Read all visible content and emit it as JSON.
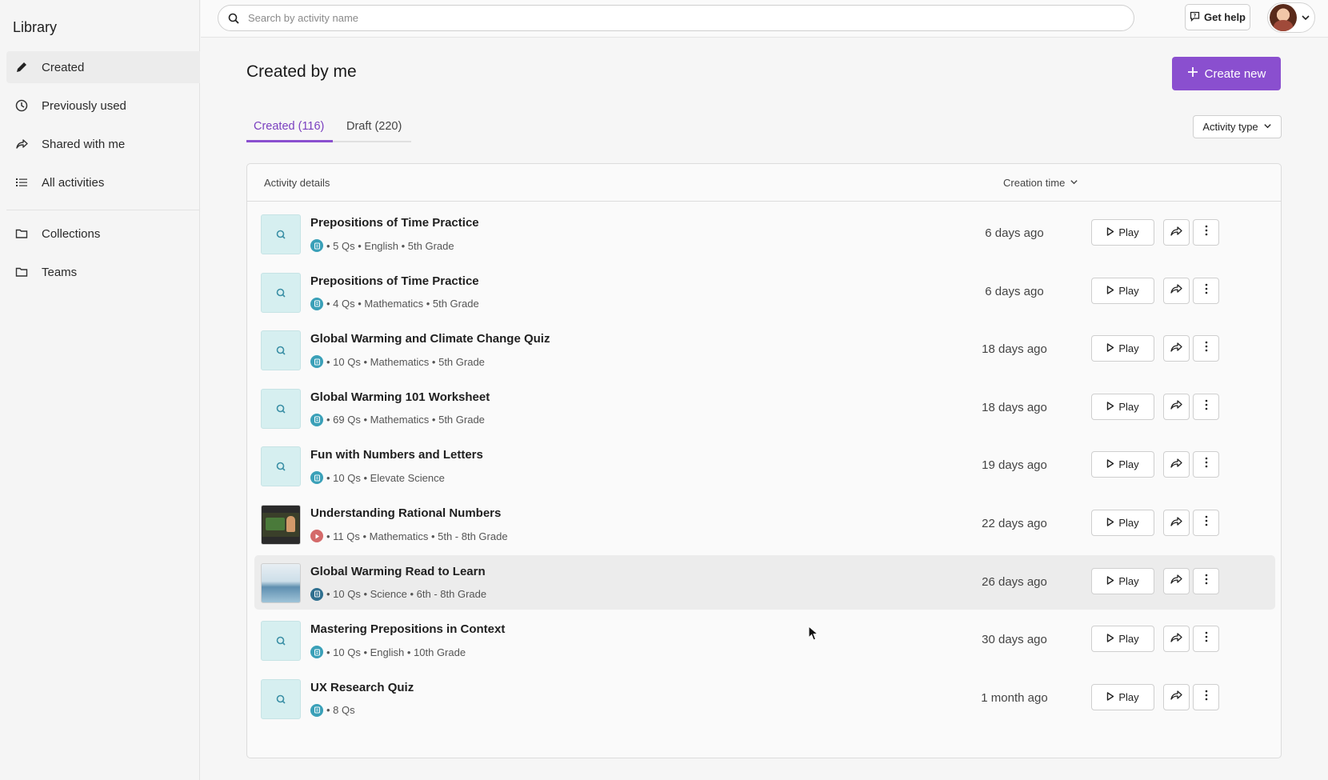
{
  "sidebar": {
    "title": "Library",
    "items": [
      {
        "label": "Created",
        "icon": "pencil-icon",
        "active": true
      },
      {
        "label": "Previously used",
        "icon": "clock-icon"
      },
      {
        "label": "Shared with me",
        "icon": "share-icon"
      },
      {
        "label": "All activities",
        "icon": "list-icon"
      },
      {
        "label": "Collections",
        "icon": "folder-icon"
      },
      {
        "label": "Teams",
        "icon": "folder-icon"
      }
    ]
  },
  "topbar": {
    "search_placeholder": "Search by activity name",
    "get_help": "Get help"
  },
  "header": {
    "title": "Created by me",
    "create_new": "Create new"
  },
  "tabs": [
    {
      "label": "Created (116)",
      "active": true
    },
    {
      "label": "Draft (220)"
    }
  ],
  "filter": {
    "activity_type": "Activity type"
  },
  "table": {
    "col_details": "Activity details",
    "col_time": "Creation time",
    "rows": [
      {
        "title": "Prepositions of Time Practice",
        "meta": "• 5 Qs • English • 5th Grade",
        "time": "6 days ago"
      },
      {
        "title": "Prepositions of Time Practice",
        "meta": "• 4 Qs • Mathematics • 5th Grade",
        "time": "6 days ago"
      },
      {
        "title": "Global Warming and Climate Change Quiz",
        "meta": "• 10 Qs • Mathematics • 5th Grade",
        "time": "18 days ago"
      },
      {
        "title": "Global Warming 101 Worksheet",
        "meta": "• 69 Qs • Mathematics • 5th Grade",
        "time": "18 days ago"
      },
      {
        "title": "Fun with Numbers and Letters",
        "meta": "• 10 Qs • Elevate Science",
        "time": "19 days ago"
      },
      {
        "title": "Understanding Rational Numbers",
        "meta": "• 11 Qs • Mathematics • 5th - 8th Grade",
        "time": "22 days ago"
      },
      {
        "title": "Global Warming Read to Learn",
        "meta": "• 10 Qs • Science • 6th - 8th Grade",
        "time": "26 days ago"
      },
      {
        "title": "Mastering Prepositions in Context",
        "meta": "• 10 Qs • English • 10th Grade",
        "time": "30 days ago"
      },
      {
        "title": "UX Research Quiz",
        "meta": "• 8 Qs",
        "time": "1 month ago"
      }
    ],
    "play_label": "Play"
  },
  "colors": {
    "accent": "#8a4fcf",
    "thumb_bg": "#d6eff0",
    "badge": "#3aa0b8"
  }
}
